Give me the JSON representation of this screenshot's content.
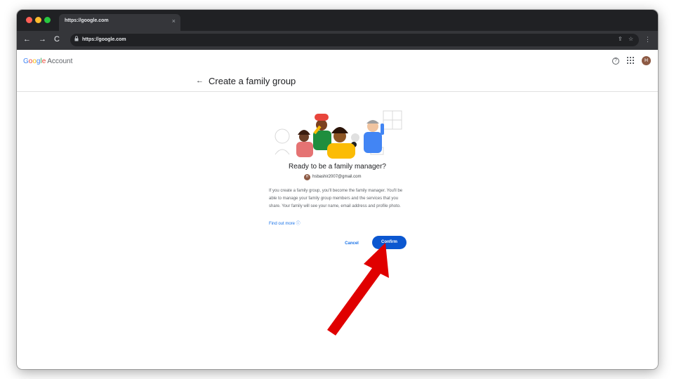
{
  "browser": {
    "tab_title": "https://google.com",
    "tab_close": "×",
    "url": "https://google.com",
    "back": "←",
    "forward": "→",
    "reload": "C",
    "share": "⇪",
    "bookmark": "☆",
    "menu": "⋮"
  },
  "account_bar": {
    "logo_letters": [
      "G",
      "o",
      "o",
      "g",
      "l",
      "e"
    ],
    "logo_suffix": "Account",
    "help": "?",
    "avatar_initial": "H"
  },
  "page": {
    "back_arrow": "←",
    "title": "Create a family group"
  },
  "content": {
    "heading": "Ready to be a family manager?",
    "avatar_initial": "H",
    "email": "hsbashir2007@gmail.com",
    "description": "If you create a family group, you'll become the family manager. You'll be able to manage your family group members and the services that you share. Your family will see your name, email address and profile photo.",
    "find_out_more": "Find out more ⓘ",
    "cancel_label": "Cancel",
    "confirm_label": "Confirm"
  },
  "colors": {
    "confirm_bg": "#0b57d0",
    "link": "#1a73e8",
    "annotation_arrow": "#e00000"
  }
}
